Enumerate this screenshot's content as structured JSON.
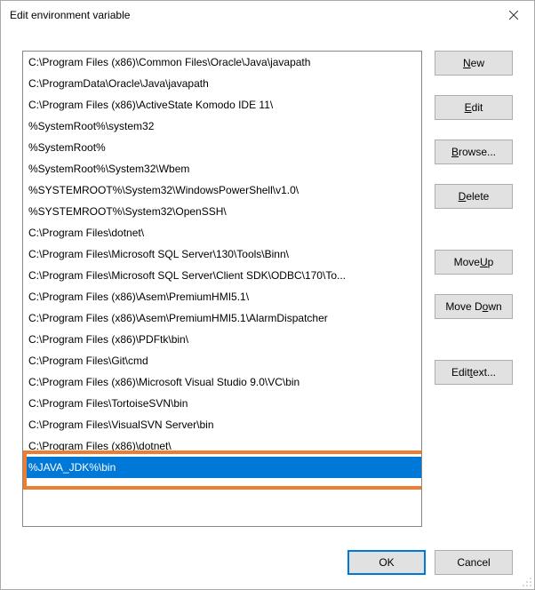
{
  "window": {
    "title": "Edit environment variable"
  },
  "list": {
    "items": [
      "C:\\Program Files (x86)\\Common Files\\Oracle\\Java\\javapath",
      "C:\\ProgramData\\Oracle\\Java\\javapath",
      "C:\\Program Files (x86)\\ActiveState Komodo IDE 11\\",
      "%SystemRoot%\\system32",
      "%SystemRoot%",
      "%SystemRoot%\\System32\\Wbem",
      "%SYSTEMROOT%\\System32\\WindowsPowerShell\\v1.0\\",
      "%SYSTEMROOT%\\System32\\OpenSSH\\",
      "C:\\Program Files\\dotnet\\",
      "C:\\Program Files\\Microsoft SQL Server\\130\\Tools\\Binn\\",
      "C:\\Program Files\\Microsoft SQL Server\\Client SDK\\ODBC\\170\\To...",
      "C:\\Program Files (x86)\\Asem\\PremiumHMI5.1\\",
      "C:\\Program Files (x86)\\Asem\\PremiumHMI5.1\\AlarmDispatcher",
      "C:\\Program Files (x86)\\PDFtk\\bin\\",
      "C:\\Program Files\\Git\\cmd",
      "C:\\Program Files (x86)\\Microsoft Visual Studio 9.0\\VC\\bin",
      "C:\\Program Files\\TortoiseSVN\\bin",
      "C:\\Program Files\\VisualSVN Server\\bin",
      "C:\\Program Files (x86)\\dotnet\\",
      "%JAVA_JDK%\\bin"
    ],
    "selected_index": 19,
    "highlighted_index": 19
  },
  "buttons": {
    "new_pre": "",
    "new_u": "N",
    "new_post": "ew",
    "edit_pre": "",
    "edit_u": "E",
    "edit_post": "dit",
    "browse_pre": "",
    "browse_u": "B",
    "browse_post": "rowse...",
    "delete_pre": "",
    "delete_u": "D",
    "delete_post": "elete",
    "moveup_pre": "Move ",
    "moveup_u": "U",
    "moveup_post": "p",
    "movedown_pre": "Move D",
    "movedown_u": "o",
    "movedown_post": "wn",
    "edittext_pre": "Edit ",
    "edittext_u": "t",
    "edittext_post": "ext...",
    "ok": "OK",
    "cancel": "Cancel"
  }
}
